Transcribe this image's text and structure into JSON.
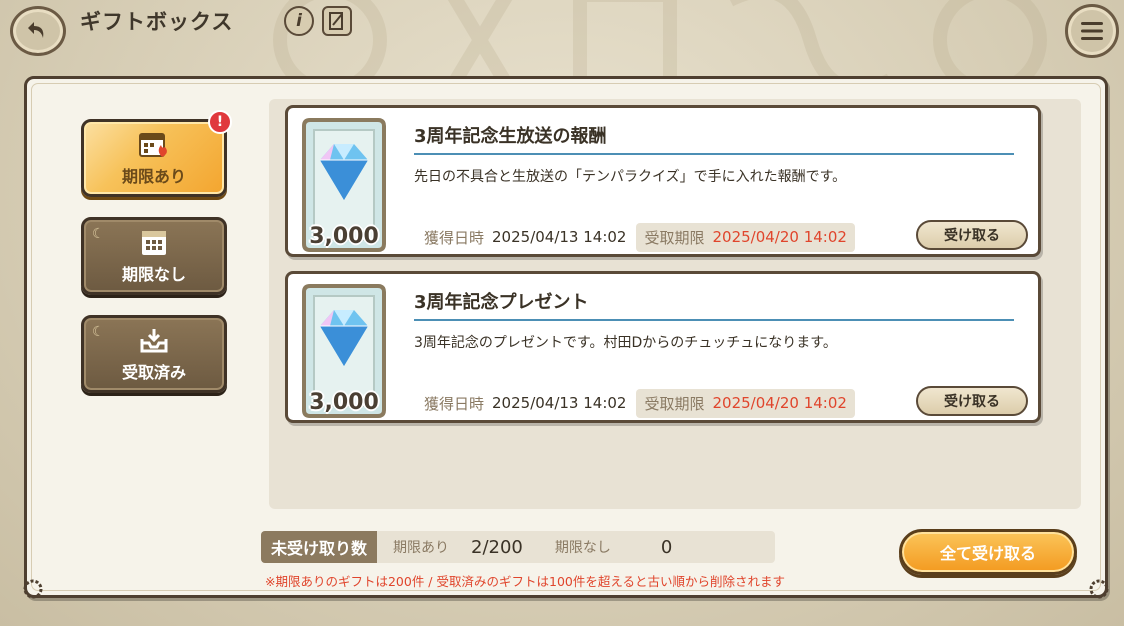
{
  "header": {
    "title": "ギフトボックス",
    "info_icon": "info-icon",
    "memo_icon": "notebook-icon",
    "back_icon": "back-arrow-icon",
    "menu_icon": "hamburger-menu-icon"
  },
  "tabs": [
    {
      "label": "期限あり",
      "icon": "calendar-fire-icon",
      "active": true,
      "badge": "!"
    },
    {
      "label": "期限なし",
      "icon": "calendar-icon",
      "active": false
    },
    {
      "label": "受取済み",
      "icon": "inbox-icon",
      "active": false
    }
  ],
  "gifts": [
    {
      "title": "3周年記念生放送の報酬",
      "description": "先日の不具合と生放送の「テンパラクイズ」で手に入れた報酬です。",
      "quantity": "3,000",
      "item_icon": "diamond-icon",
      "acquired_label": "獲得日時",
      "acquired_value": "2025/04/13 14:02",
      "deadline_label": "受取期限",
      "deadline_value": "2025/04/20 14:02",
      "claim_label": "受け取る"
    },
    {
      "title": "3周年記念プレゼント",
      "description": "3周年記念のプレゼントです。村田Dからのチュッチュになります。",
      "quantity": "3,000",
      "item_icon": "diamond-icon",
      "acquired_label": "獲得日時",
      "acquired_value": "2025/04/13 14:02",
      "deadline_label": "受取期限",
      "deadline_value": "2025/04/20 14:02",
      "claim_label": "受け取る"
    }
  ],
  "footer": {
    "unclaimed_title": "未受け取り数",
    "limited_label": "期限あり",
    "limited_value": "2/200",
    "unlimited_label": "期限なし",
    "unlimited_value": "0",
    "note": "※期限ありのギフトは200件 / 受取済みのギフトは100件を超えると古い順から削除されます",
    "claim_all_label": "全て受け取る"
  },
  "colors": {
    "accent_orange": "#f39a20",
    "deadline_red": "#e0452c",
    "rule_blue": "#4c8fb5",
    "frame_brown": "#4e3f30"
  }
}
